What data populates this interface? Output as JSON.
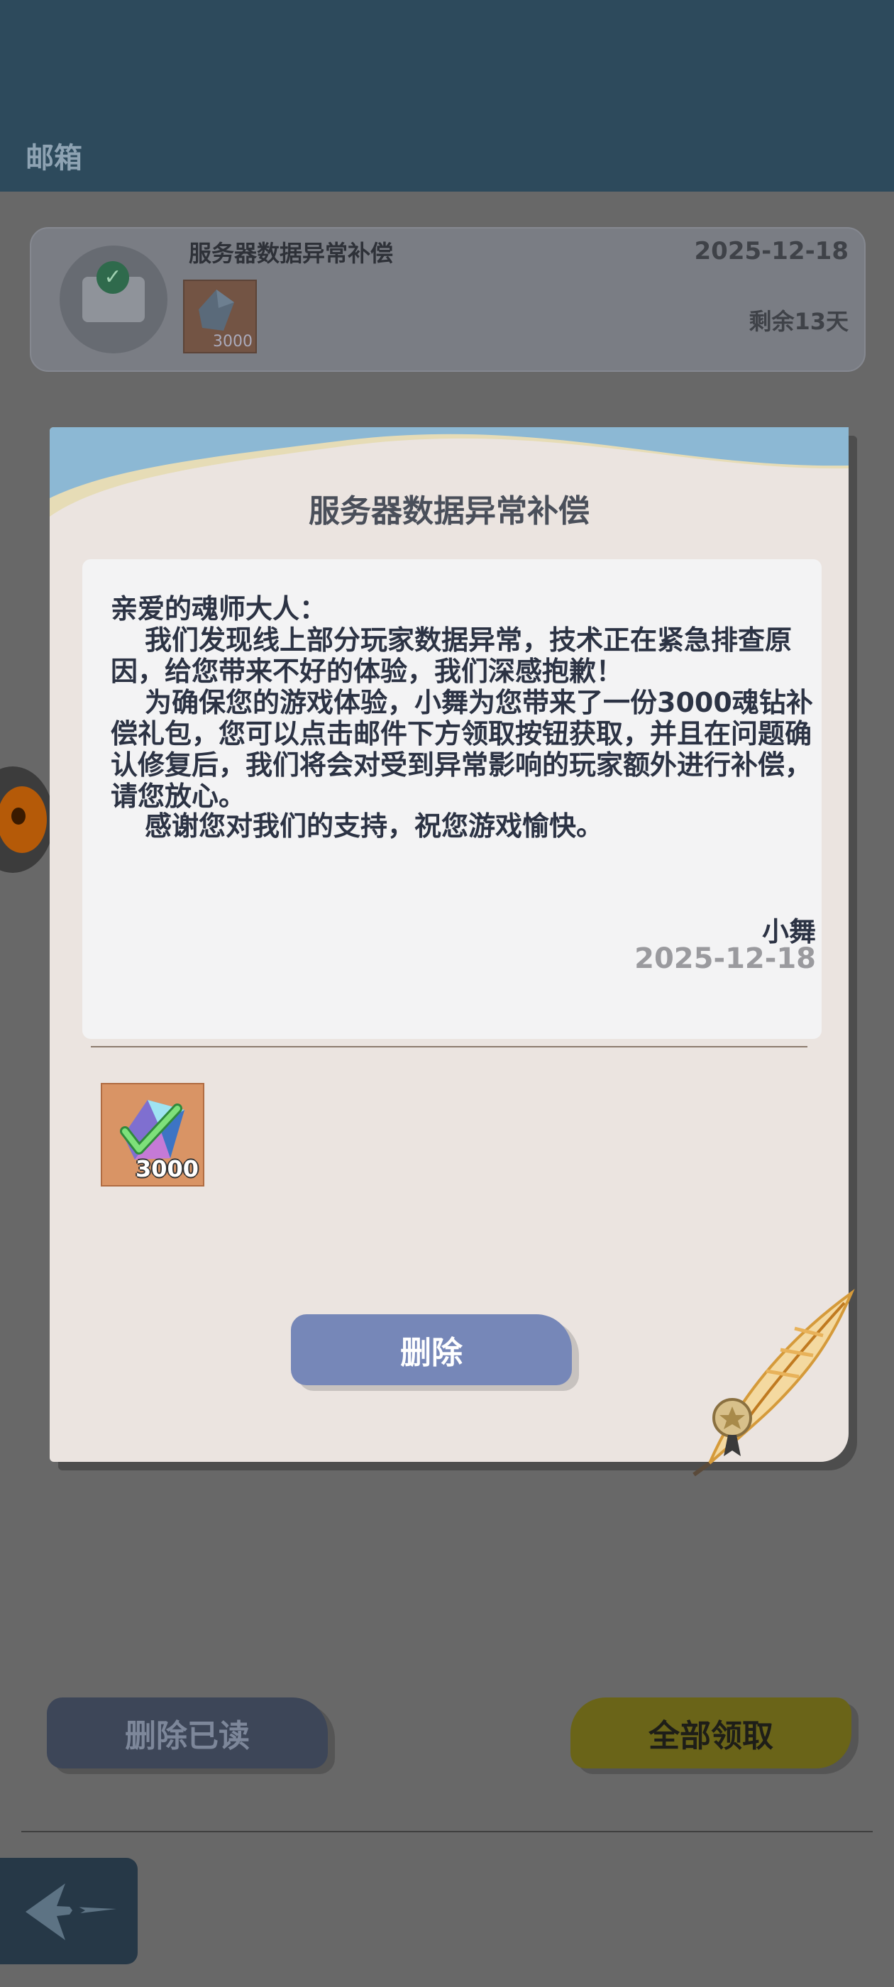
{
  "header": {
    "title": "邮箱"
  },
  "mail_list": [
    {
      "subject": "服务器数据异常补偿",
      "date": "2025-12-18",
      "remaining": "剩余13天",
      "attachment_amount": "3000"
    }
  ],
  "modal": {
    "title": "服务器数据异常补偿",
    "greeting": "亲爱的魂师大人：",
    "paragraphs": [
      "我们发现线上部分玩家数据异常，技术正在紧急排查原因，给您带来不好的体验，我们深感抱歉！",
      "为确保您的游戏体验，小舞为您带来了一份3000魂钻补偿礼包，您可以点击邮件下方领取按钮获取，并且在问题确认修复后，我们将会对受到异常影响的玩家额外进行补偿，请您放心。",
      "感谢您对我们的支持，祝您游戏愉快。"
    ],
    "signature": "小舞",
    "date": "2025-12-18",
    "reward_amount": "3000",
    "delete_label": "删除"
  },
  "footer": {
    "delete_read_label": "删除已读",
    "claim_all_label": "全部领取"
  },
  "icons": {
    "mail": "envelope-check-icon",
    "reward": "soul-diamond-icon",
    "back": "back-arrow-icon",
    "decor": "quill-feather-icon"
  },
  "colors": {
    "header_bg": "#2d4a5c",
    "modal_bg": "#ebe4e0",
    "delete_button": "#7687b8",
    "claim_all_button": "#6a6418"
  }
}
